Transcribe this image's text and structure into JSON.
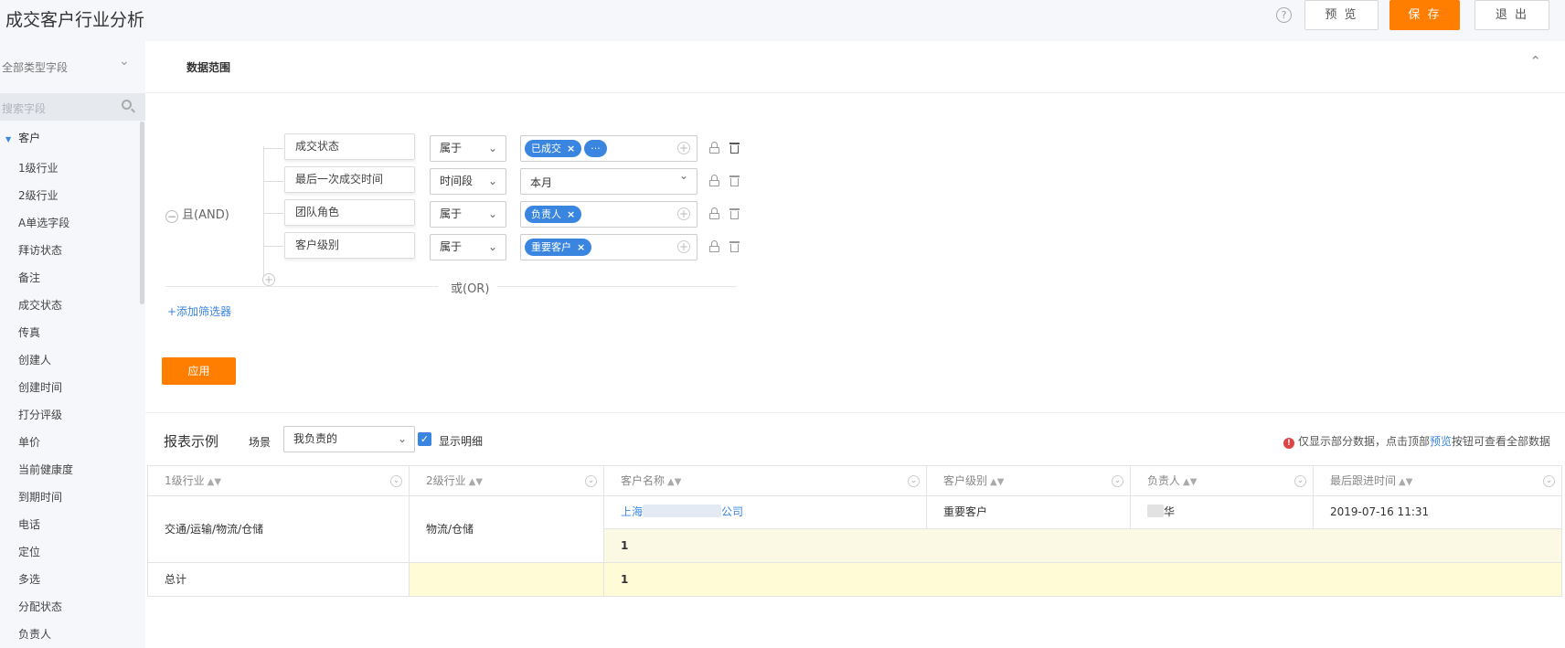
{
  "header": {
    "title": "成交客户行业分析",
    "help_icon": "?",
    "preview_label": "预 览",
    "save_label": "保 存",
    "exit_label": "退 出"
  },
  "sidebar": {
    "field_type": "全部类型字段",
    "search_placeholder": "搜索字段",
    "group": "客户",
    "items": [
      "1级行业",
      "2级行业",
      "A单选字段",
      "拜访状态",
      "备注",
      "成交状态",
      "传真",
      "创建人",
      "创建时间",
      "打分评级",
      "单价",
      "当前健康度",
      "到期时间",
      "电话",
      "定位",
      "多选",
      "分配状态",
      "负责人"
    ]
  },
  "data_range": {
    "title": "数据范围",
    "logic_label": "且(AND)",
    "or_label": "或(OR)",
    "add_filter": "+添加筛选器",
    "apply_label": "应用",
    "conditions": [
      {
        "field": "成交状态",
        "op": "属于",
        "tags": [
          "已成交",
          "···"
        ],
        "value": ""
      },
      {
        "field": "最后一次成交时间",
        "op": "时间段",
        "tags": [],
        "value": "本月"
      },
      {
        "field": "团队角色",
        "op": "属于",
        "tags": [
          "负责人"
        ],
        "value": ""
      },
      {
        "field": "客户级别",
        "op": "属于",
        "tags": [
          "重要客户"
        ],
        "value": ""
      }
    ]
  },
  "report": {
    "title": "报表示例",
    "scene_label": "场景",
    "scene_value": "我负责的",
    "show_detail": "显示明细",
    "notice_prefix": "仅显示部分数据，点击顶部",
    "notice_link": "预览",
    "notice_suffix": "按钮可查看全部数据",
    "columns": [
      "1级行业",
      "2级行业",
      "客户名称",
      "客户级别",
      "负责人",
      "最后跟进时间"
    ],
    "row": {
      "industry1": "交通/运输/物流/仓储",
      "industry2": "物流/仓储",
      "customer_prefix": "上海",
      "customer_suffix": "公司",
      "level": "重要客户",
      "owner_suffix": "华",
      "last_follow": "2019-07-16 11:31",
      "subtotal": "1"
    },
    "total_label": "总计",
    "total_value": "1"
  }
}
